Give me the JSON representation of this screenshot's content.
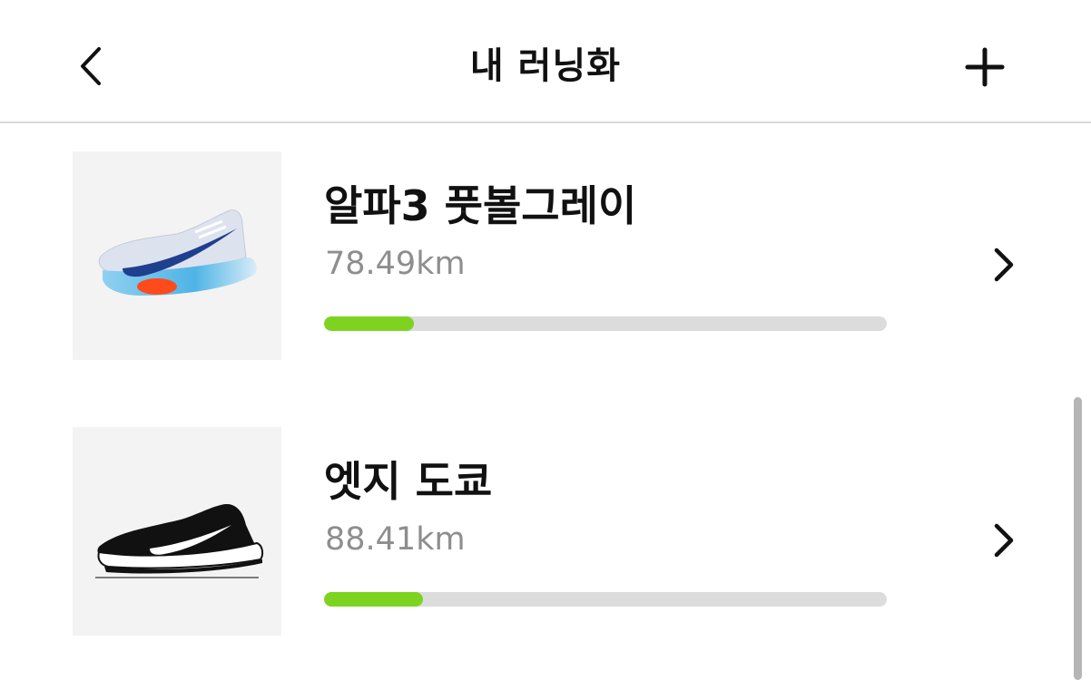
{
  "header": {
    "title": "내 러닝화",
    "back_icon": "chevron-left-icon",
    "add_icon": "plus-icon"
  },
  "shoes": [
    {
      "name": "알파3 풋볼그레이",
      "distance": "78.49km",
      "progress": 0.16,
      "image": "blue-white-racing-shoe-image"
    },
    {
      "name": "엣지 도쿄",
      "distance": "88.41km",
      "progress": 0.175,
      "image": "black-slip-on-shoe-image"
    }
  ],
  "colors": {
    "progress_fill": "#7ed321",
    "progress_track": "#dcdcdc",
    "thumb_bg": "#f3f3f3",
    "distance_text": "#8e8e8e"
  }
}
